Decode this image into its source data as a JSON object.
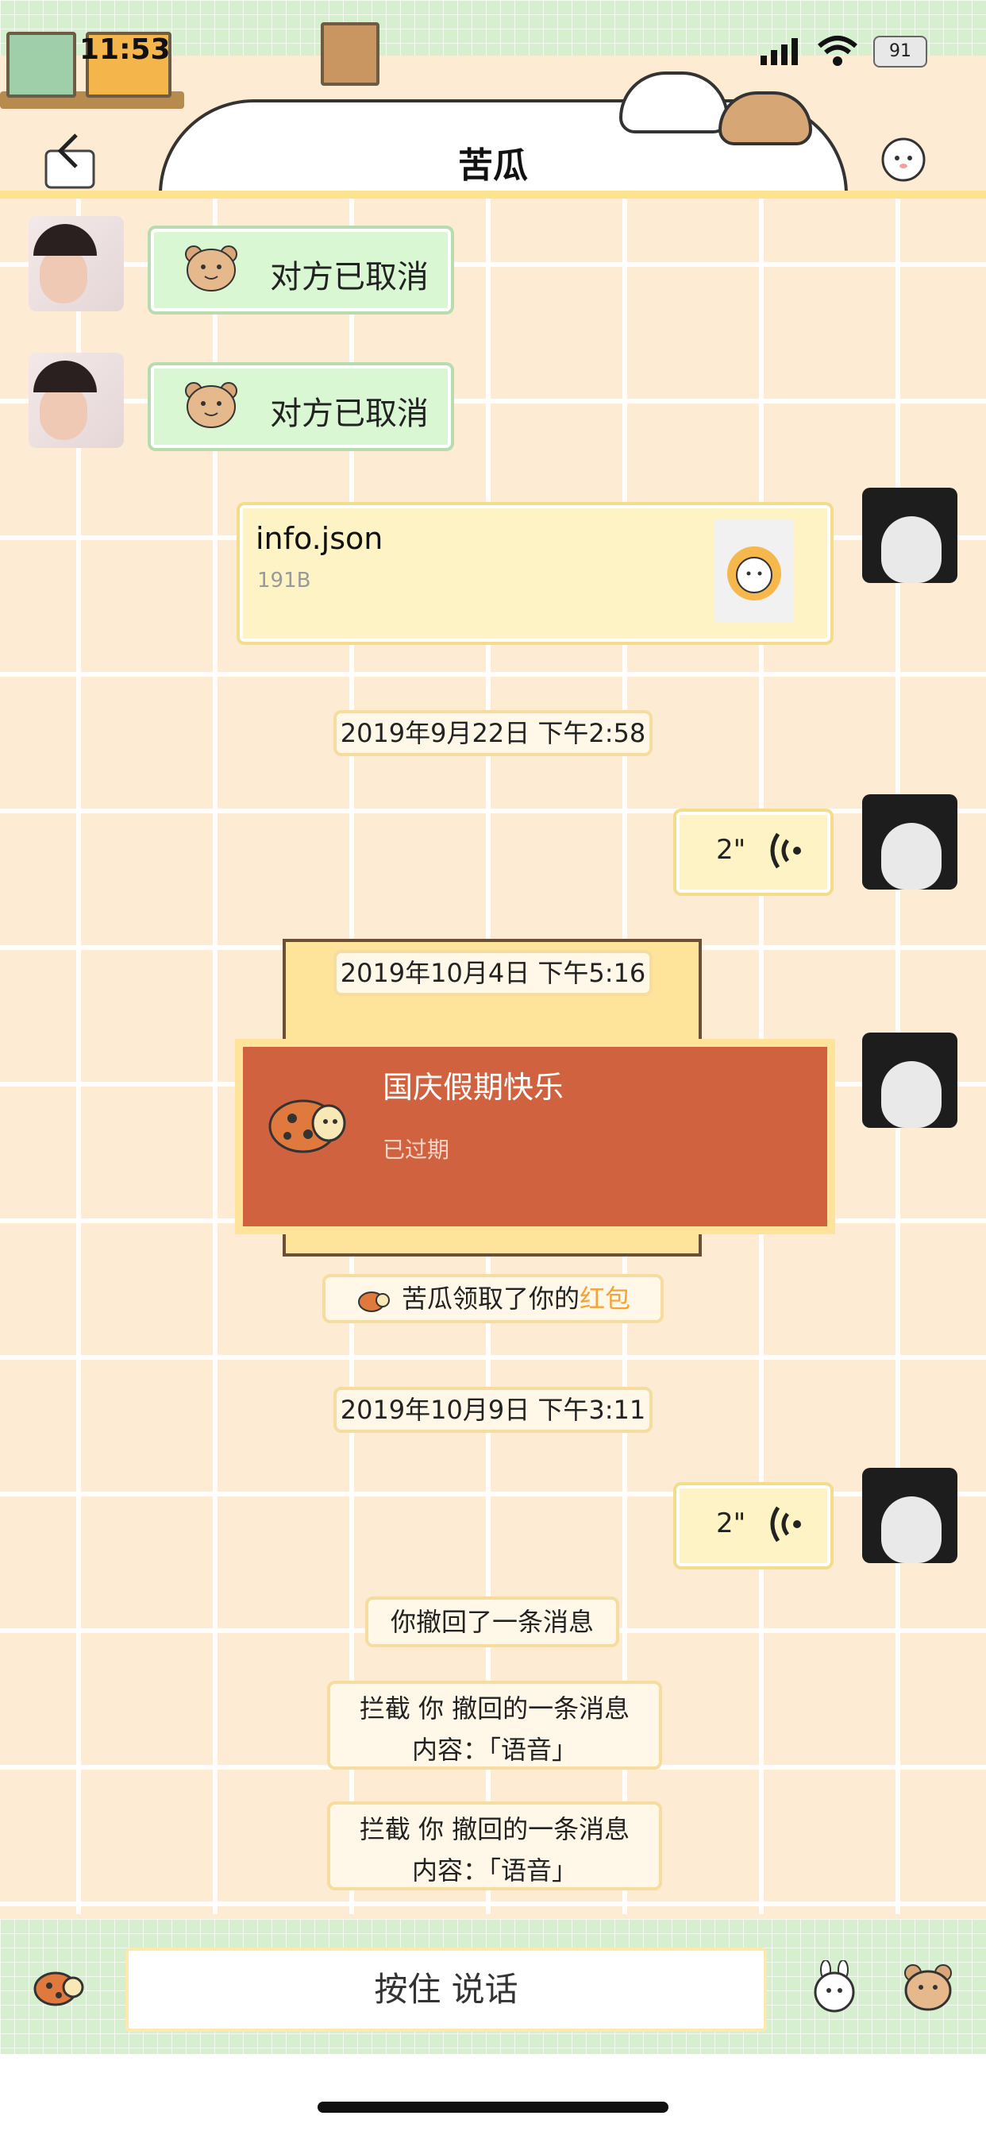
{
  "status": {
    "time": "11:53",
    "battery": "91"
  },
  "header": {
    "title": "苦瓜"
  },
  "messages": {
    "call1": "对方已取消",
    "call2": "对方已取消",
    "file": {
      "name": "info.json",
      "size": "191B"
    },
    "ts1": "2019年9月22日 下午2:58",
    "voice1": "2\"",
    "ts2": "2019年10月4日 下午5:16",
    "redpacket": {
      "title": "国庆假期快乐",
      "status": "已过期"
    },
    "notice": {
      "prefix": "苦瓜领取了你的",
      "highlight": "红包"
    },
    "ts3": "2019年10月9日 下午3:11",
    "voice2": "2\"",
    "recalled": "你撤回了一条消息",
    "intercept1": {
      "line1": "拦截 你 撤回的一条消息",
      "line2": "内容：「语音」"
    },
    "intercept2": {
      "line1": "拦截 你 撤回的一条消息",
      "line2": "内容：「语音」"
    }
  },
  "bottom": {
    "talk_label": "按住 说话"
  },
  "colors": {
    "background": "#fdebd3",
    "green_bubble": "#d9f7d2",
    "yellow_bubble": "#fdf3c4",
    "red_packet": "#d1623f",
    "accent_orange": "#f5a338"
  }
}
